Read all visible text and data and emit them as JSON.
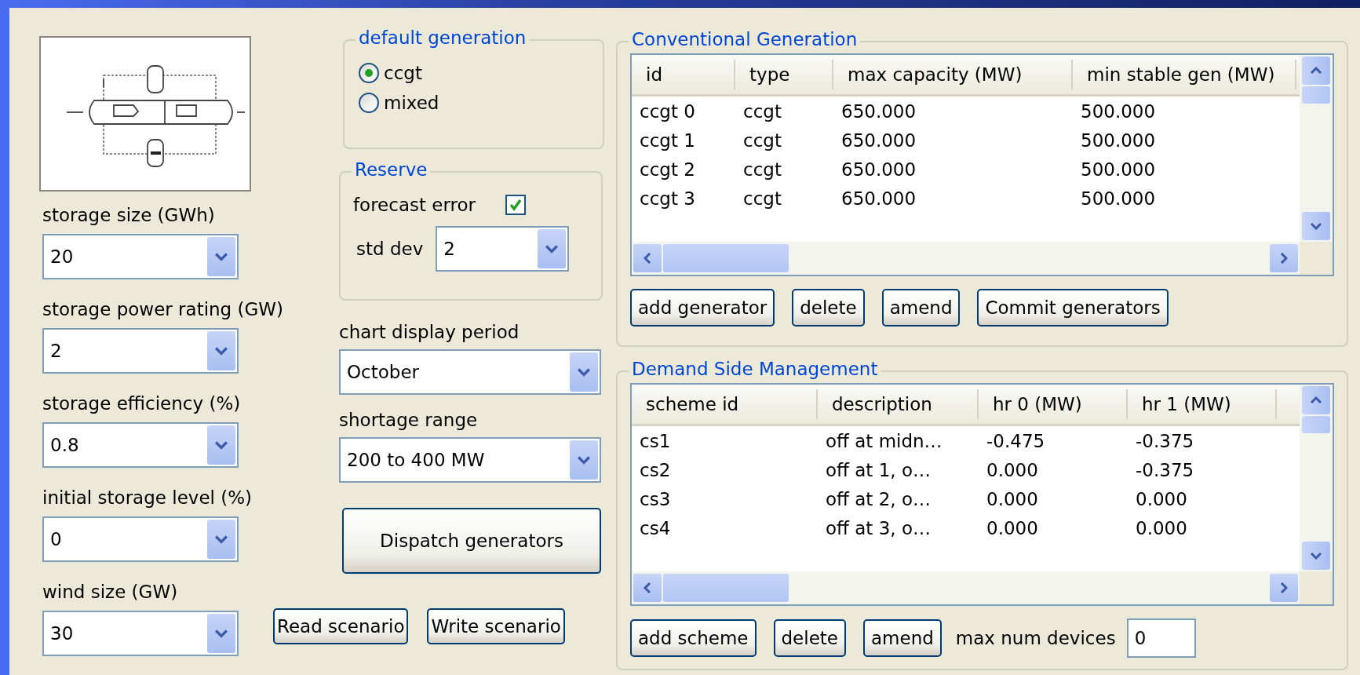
{
  "storage_settings": [
    {
      "label": "storage size (GWh)",
      "value": "20"
    },
    {
      "label": "storage power rating (GW)",
      "value": "2"
    },
    {
      "label": "storage efficiency (%)",
      "value": "0.8"
    },
    {
      "label": "initial storage level (%)",
      "value": "0"
    },
    {
      "label": "wind size (GW)",
      "value": "30"
    }
  ],
  "default_generation": {
    "title": "default generation",
    "options": [
      {
        "label": "ccgt",
        "selected": true
      },
      {
        "label": "mixed",
        "selected": false
      }
    ]
  },
  "reserve": {
    "title": "Reserve",
    "forecast_error": {
      "label": "forecast error",
      "checked": true
    },
    "std_dev": {
      "label": "std dev",
      "value": "2"
    }
  },
  "chart_display_period": {
    "label": "chart display period",
    "value": "October"
  },
  "shortage_range": {
    "label": "shortage range",
    "value": "200 to 400 MW"
  },
  "dispatch_button": "Dispatch generators",
  "scenario_buttons": [
    "Read scenario",
    "Write scenario"
  ],
  "conventional_generation": {
    "title": "Conventional Generation",
    "columns": [
      "id",
      "type",
      "max capacity (MW)",
      "min stable gen (MW)"
    ],
    "rows": [
      [
        "ccgt 0",
        "ccgt",
        "650.000",
        "500.000"
      ],
      [
        "ccgt 1",
        "ccgt",
        "650.000",
        "500.000"
      ],
      [
        "ccgt 2",
        "ccgt",
        "650.000",
        "500.000"
      ],
      [
        "ccgt 3",
        "ccgt",
        "650.000",
        "500.000"
      ]
    ],
    "buttons": [
      "add generator",
      "delete",
      "amend",
      "Commit generators"
    ]
  },
  "demand_side_management": {
    "title": "Demand Side Management",
    "columns": [
      "scheme id",
      "description",
      "hr 0 (MW)",
      "hr 1 (MW)"
    ],
    "rows": [
      [
        "cs1",
        "off at midn…",
        "-0.475",
        "-0.375"
      ],
      [
        "cs2",
        "off at 1, o…",
        "0.000",
        "-0.375"
      ],
      [
        "cs3",
        "off at 2, o…",
        "0.000",
        "0.000"
      ],
      [
        "cs4",
        "off at 3, o…",
        "0.000",
        "0.000"
      ]
    ],
    "buttons": [
      "add scheme",
      "delete",
      "amend"
    ],
    "max_num_devices": {
      "label": "max num devices",
      "value": "0"
    }
  }
}
